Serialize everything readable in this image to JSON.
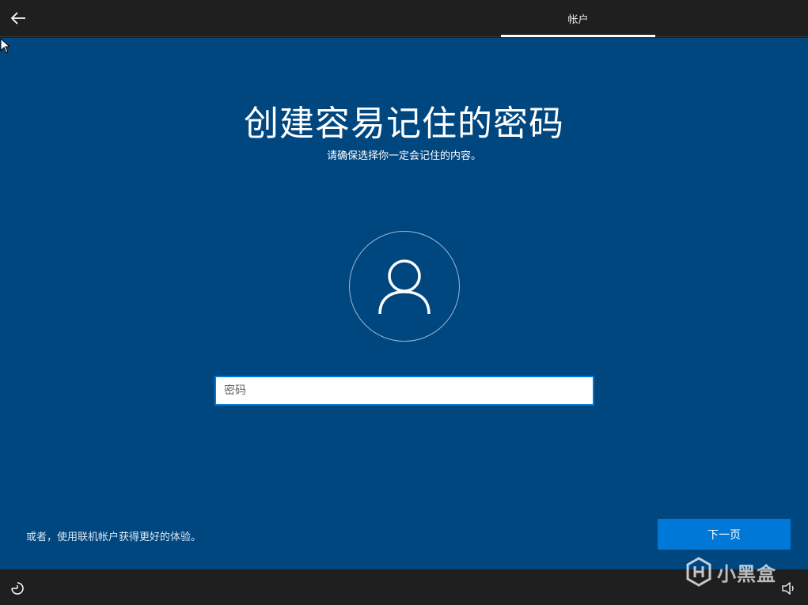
{
  "header": {
    "back_icon": "arrow-left-icon",
    "tab_label": "帐户"
  },
  "main": {
    "title": "创建容易记住的密码",
    "subtitle": "请确保选择你一定会记住的内容。",
    "avatar_icon": "user-icon",
    "password_placeholder": "密码",
    "password_value": "",
    "alt_link": "或者，使用联机帐户获得更好的体验。",
    "next_label": "下一页"
  },
  "footer": {
    "ease_icon": "ease-of-access-icon",
    "volume_icon": "volume-icon"
  },
  "watermark": {
    "logo_icon": "xiaoheihe-logo-icon",
    "text": "小黑盒"
  },
  "colors": {
    "background": "#00467f",
    "bar": "#1f1f1f",
    "accent": "#0078d7"
  }
}
